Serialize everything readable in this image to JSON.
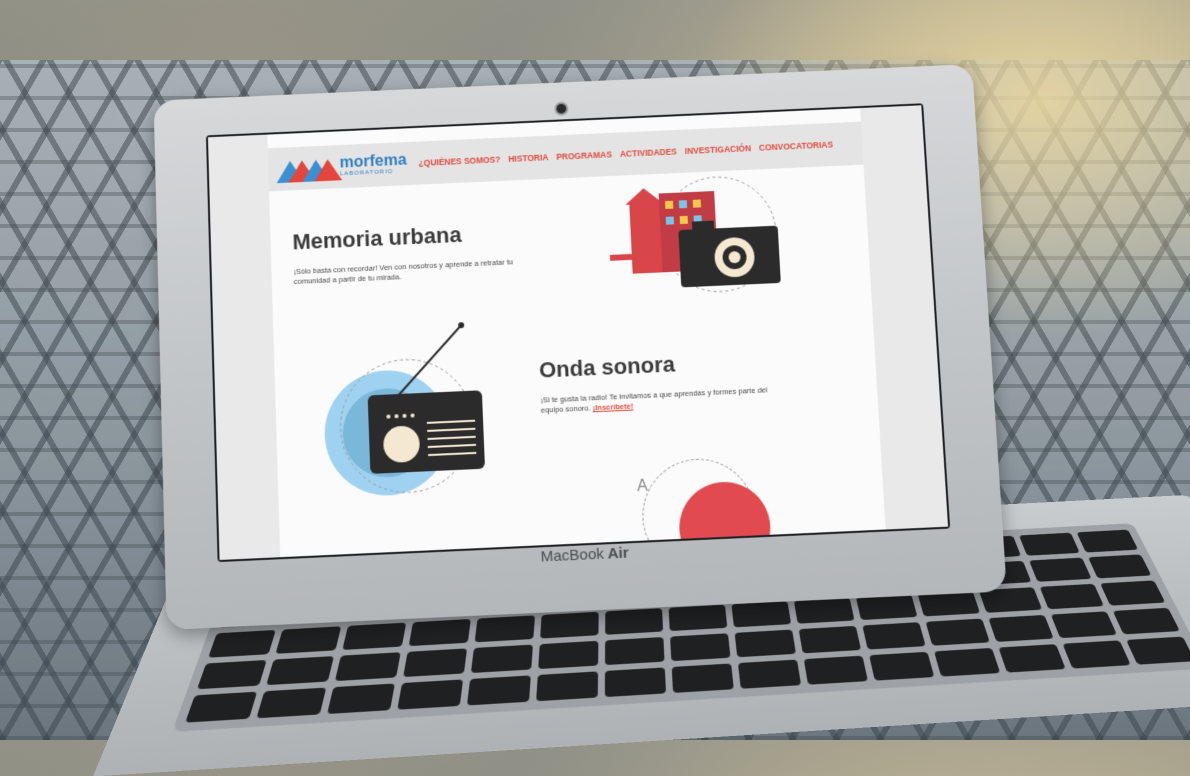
{
  "device": {
    "label_regular": "MacBook",
    "label_bold": " Air"
  },
  "site": {
    "logo": {
      "name": "morfema",
      "sub": "LABORATORIO"
    },
    "nav": [
      {
        "label": "¿QUIÉNES SOMOS?"
      },
      {
        "label": "HISTORIA"
      },
      {
        "label": "PROGRAMAS"
      },
      {
        "label": "ACTIVIDADES"
      },
      {
        "label": "INVESTIGACIÓN"
      },
      {
        "label": "CONVOCATORIAS"
      }
    ],
    "sections": {
      "memoria": {
        "title": "Memoria urbana",
        "text": "¡Sólo basta con recordar! Ven con nosotros y aprende a retratar tu comunidad a partir de tu mirada."
      },
      "onda": {
        "title": "Onda sonora",
        "text": "¡Si te gusta la radio! Te invitamos a que aprendas y formes parte del equipo sonoro.",
        "cta": "¡Inscríbete!"
      },
      "third_glyph": "A"
    }
  },
  "colors": {
    "accent_red": "#e14a3d",
    "accent_blue": "#3b8fd2",
    "dark": "#2b2b2b"
  }
}
